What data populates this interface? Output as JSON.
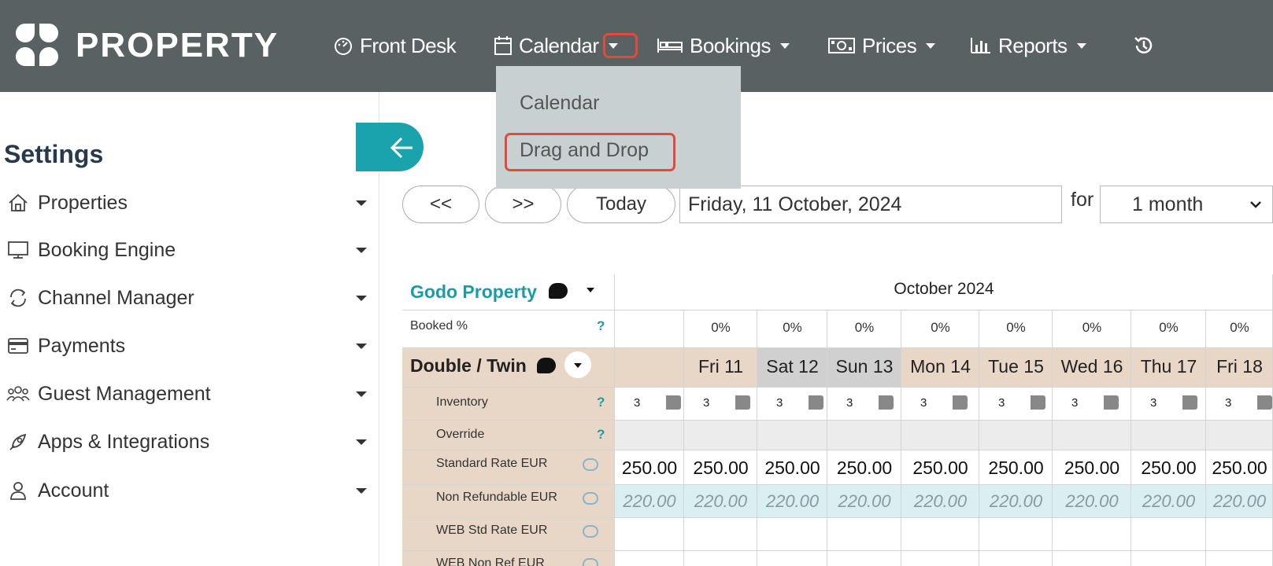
{
  "app": {
    "logo_text": "PROPERTY"
  },
  "nav": {
    "items": [
      {
        "label": "Front Desk"
      },
      {
        "label": "Calendar"
      },
      {
        "label": "Bookings"
      },
      {
        "label": "Prices"
      },
      {
        "label": "Reports"
      }
    ]
  },
  "calendar_menu": {
    "items": [
      {
        "label": "Calendar"
      },
      {
        "label": "Drag and Drop"
      }
    ]
  },
  "sidebar": {
    "title": "Settings",
    "items": [
      {
        "label": "Properties",
        "icon": "home-icon"
      },
      {
        "label": "Booking Engine",
        "icon": "monitor-icon"
      },
      {
        "label": "Channel Manager",
        "icon": "sync-icon"
      },
      {
        "label": "Payments",
        "icon": "credit-card-icon"
      },
      {
        "label": "Guest Management",
        "icon": "users-icon"
      },
      {
        "label": "Apps & Integrations",
        "icon": "rocket-icon"
      },
      {
        "label": "Account",
        "icon": "user-icon"
      }
    ]
  },
  "controls": {
    "prev_label": "<<",
    "next_label": ">>",
    "today_label": "Today",
    "date_value": "Friday, 11 October, 2024",
    "for_label": "for",
    "period_value": "1 month"
  },
  "grid": {
    "property_name": "Godo Property",
    "month_label": "October 2024",
    "booked_label": "Booked %",
    "room_name": "Double / Twin",
    "row_labels": {
      "inventory": "Inventory",
      "override": "Override",
      "standard": "Standard Rate EUR",
      "nonref": "Non Refundable EUR",
      "web_std": "WEB Std Rate EUR",
      "web_nonref": "WEB Non Ref EUR"
    },
    "question_mark": "?",
    "days": [
      "",
      "Fri 11",
      "Sat 12",
      "Sun 13",
      "Mon 14",
      "Tue 15",
      "Wed 16",
      "Thu 17",
      "Fri 18"
    ],
    "booked": [
      "",
      "0%",
      "0%",
      "0%",
      "0%",
      "0%",
      "0%",
      "0%",
      "0%"
    ],
    "inventory": [
      "3",
      "3",
      "3",
      "3",
      "3",
      "3",
      "3",
      "3",
      "3"
    ],
    "standard_rates": [
      "250.00",
      "250.00",
      "250.00",
      "250.00",
      "250.00",
      "250.00",
      "250.00",
      "250.00",
      "250.00"
    ],
    "nonref_rates": [
      "220.00",
      "220.00",
      "220.00",
      "220.00",
      "220.00",
      "220.00",
      "220.00",
      "220.00",
      "220.00"
    ]
  },
  "colors": {
    "topbar": "#5a6163",
    "accent": "#1aa3ad",
    "room_bg": "#e8d7c7",
    "weekend_bg": "#d0d0d0",
    "nonref_bg": "#d9eff1",
    "highlight": "#e04a3f"
  }
}
